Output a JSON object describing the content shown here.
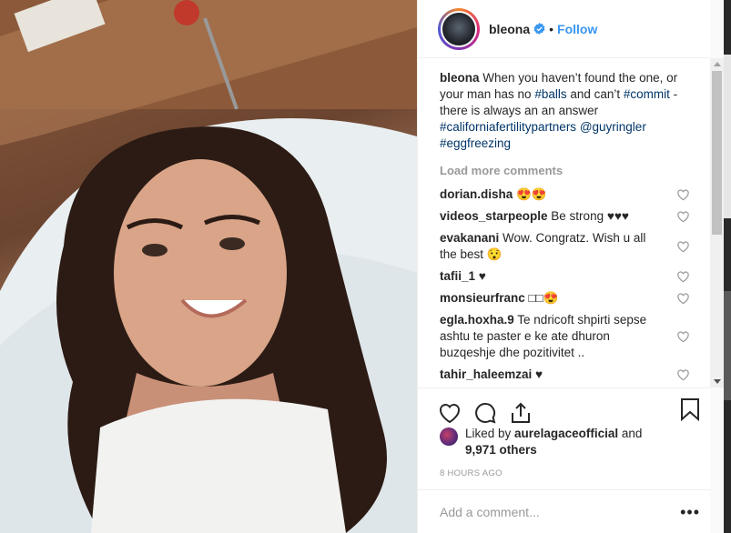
{
  "post": {
    "username": "bleona",
    "follow_label": "Follow",
    "separator": "•",
    "caption": {
      "user": "bleona",
      "parts": [
        {
          "t": " When you haven’t found the one, or your man has no ",
          "tag": false
        },
        {
          "t": "#balls",
          "tag": true
        },
        {
          "t": " and can’t ",
          "tag": false
        },
        {
          "t": "#commit",
          "tag": true
        },
        {
          "t": " - there is always an an answer ",
          "tag": false
        },
        {
          "t": "#californiafertilitypartners",
          "tag": true
        },
        {
          "t": " ",
          "tag": false
        },
        {
          "t": "@guyringler",
          "tag": true
        },
        {
          "t": " ",
          "tag": false
        },
        {
          "t": "#eggfreezing",
          "tag": true
        }
      ]
    },
    "load_more": "Load more comments",
    "comments": [
      {
        "user": "dorian.disha",
        "text": "😍😍"
      },
      {
        "user": "videos_starpeople",
        "text": "Be strong ♥♥♥"
      },
      {
        "user": "evakanani",
        "text": "Wow. Congratz. Wish u all the best 😯"
      },
      {
        "user": "tafii_1",
        "text": "♥"
      },
      {
        "user": "monsieurfranc",
        "text": "□□😍"
      },
      {
        "user": "egla.hoxha.9",
        "text": "Te ndricoft shpirti sepse ashtu te paster e ke ate dhuron buzqeshje dhe pozitivitet .."
      },
      {
        "user": "tahir_haleemzai",
        "text": "♥"
      }
    ],
    "liked_by_prefix": "Liked by ",
    "liked_by_user": "aurelagaceofficial",
    "liked_by_and": " and",
    "likes_count": "9,971 others",
    "timestamp": "8 HOURS AGO",
    "add_comment_placeholder": "Add a comment...",
    "more_options": "•••"
  },
  "colors": {
    "accent": "#3897f0",
    "hashtag": "#003569",
    "muted": "#999999",
    "text": "#262626"
  },
  "icons": [
    "verified-badge-icon",
    "heart-icon",
    "comment-icon",
    "share-icon",
    "bookmark-icon",
    "small-heart-icon"
  ]
}
